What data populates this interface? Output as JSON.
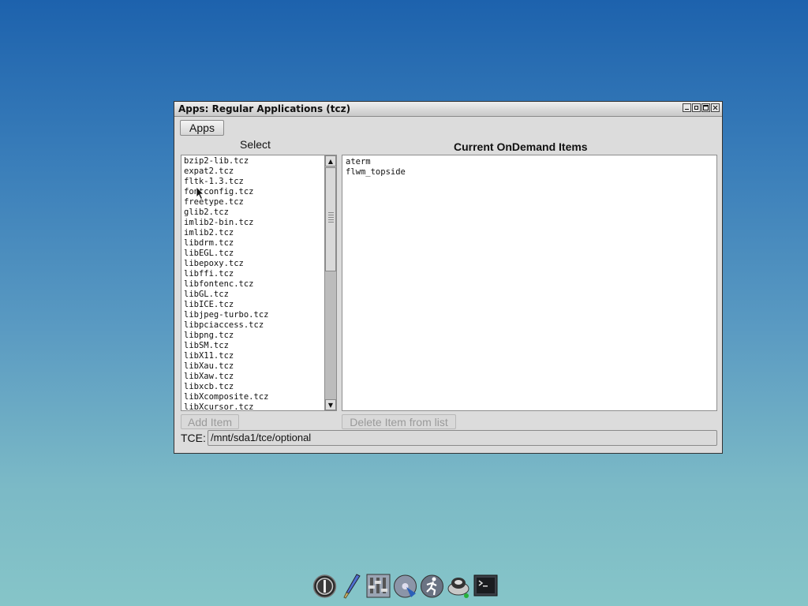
{
  "window": {
    "title": "Apps: Regular Applications (tcz)",
    "controls": [
      "minimize-icon",
      "restore-icon",
      "maximize-icon",
      "close-icon"
    ]
  },
  "apps_button": "Apps",
  "select_label": "Select",
  "current_label": "Current OnDemand Items",
  "select_list": [
    "bzip2-lib.tcz",
    "expat2.tcz",
    "fltk-1.3.tcz",
    "fontconfig.tcz",
    "freetype.tcz",
    "glib2.tcz",
    "imlib2-bin.tcz",
    "imlib2.tcz",
    "libdrm.tcz",
    "libEGL.tcz",
    "libepoxy.tcz",
    "libffi.tcz",
    "libfontenc.tcz",
    "libGL.tcz",
    "libICE.tcz",
    "libjpeg-turbo.tcz",
    "libpciaccess.tcz",
    "libpng.tcz",
    "libSM.tcz",
    "libX11.tcz",
    "libXau.tcz",
    "libXaw.tcz",
    "libxcb.tcz",
    "libXcomposite.tcz",
    "libXcursor.tcz"
  ],
  "ondemand_list": [
    "aterm",
    "flwm_topside"
  ],
  "add_item_button": "Add Item",
  "delete_item_button": "Delete Item from list",
  "tce": {
    "label": "TCE:",
    "value": "/mnt/sda1/tce/optional"
  },
  "colors": {
    "desktop_top": "#1d62ad",
    "desktop_bottom": "#86c5c8",
    "window_bg": "#dcdcdc"
  },
  "dock_icons": [
    "power-icon",
    "brush-icon",
    "control-panel-icon",
    "mount-icon",
    "run-icon",
    "apps-icon",
    "terminal-icon"
  ]
}
